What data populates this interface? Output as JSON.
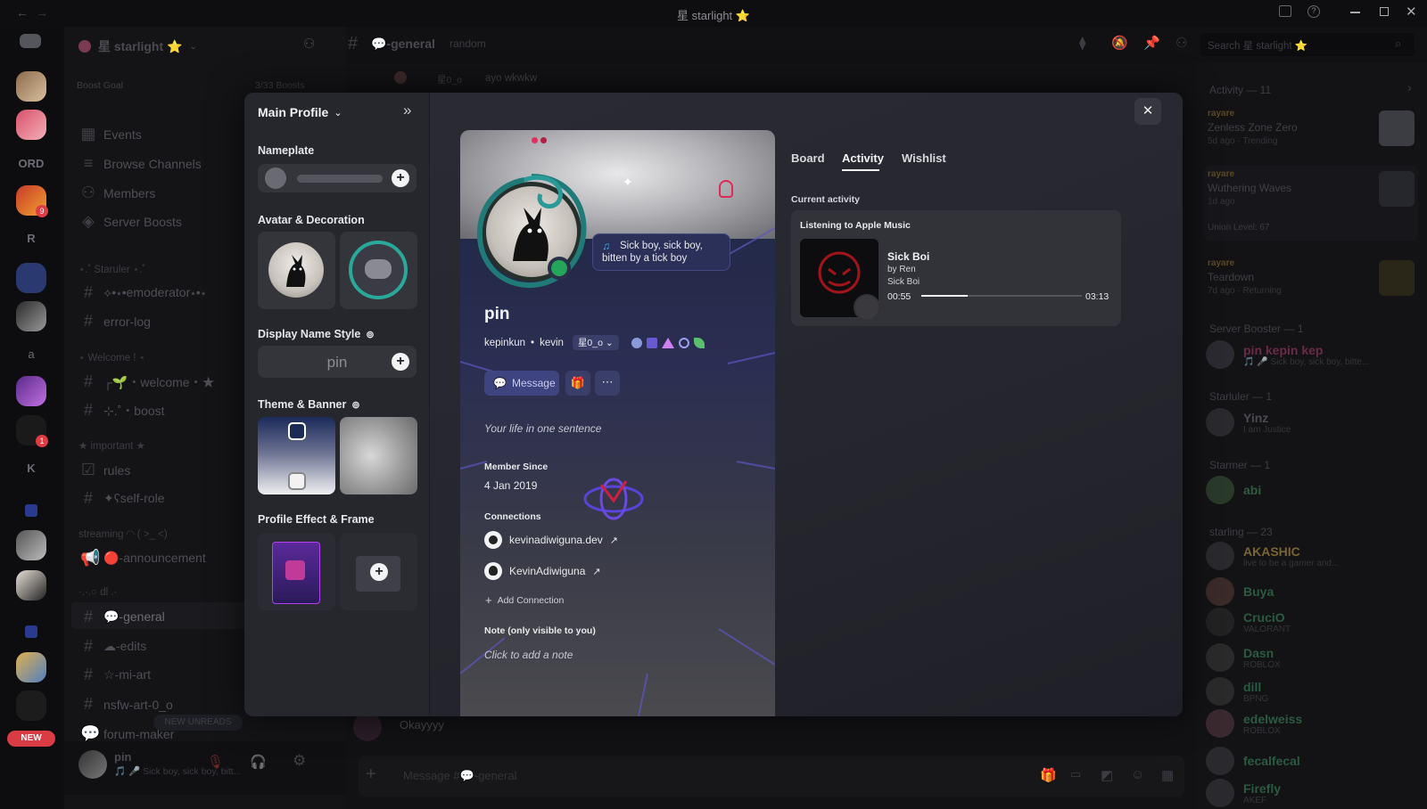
{
  "titlebar": {
    "title": "星 starlight ⭐"
  },
  "servers": {
    "labels": [
      "ORD",
      "R",
      "a",
      "K"
    ],
    "badges": [
      "9",
      "1"
    ],
    "new_label": "NEW"
  },
  "channels": {
    "server_name": "星 starlight ⭐",
    "boost_goal": "Boost Goal",
    "boost_count": "3/33 Boosts",
    "nav": [
      "Events",
      "Browse Channels",
      "Members",
      "Server Boosts"
    ],
    "cats": [
      "⋆.˚ Staruler ⋆.˚",
      "⋆ Welcome ! ⋆",
      "★ important ★",
      "streaming ◜◝ ( >_ <)",
      "·.·.○ dl .·"
    ],
    "items": [
      "⟡•⋆•emoderator⋆•⋆",
      "error-log",
      "┌🌱・welcome・★",
      "⊹.˚・boost",
      "rules",
      "✦ʕself-role",
      "🔴-announcement",
      "💬-general",
      "☁-edits",
      "☆-mi-art",
      "nsfw-art-0_o",
      "forum-maker"
    ],
    "new_unreads": "NEW UNREADS",
    "user_name": "pin",
    "user_status": "🎵 🎤 Sick boy, sick boy, bitt..."
  },
  "header": {
    "channel": "💬-general",
    "topic": "random",
    "search": "Search 星 starlight ⭐"
  },
  "messages": {
    "m1_name": "星0_o",
    "m1_text": "ayo wkwkw",
    "m2_text": "Okayyyy",
    "composer": "Message #💬-general"
  },
  "members": {
    "activity_head": "Activity — 11",
    "acts": [
      {
        "user": "rayare",
        "game": "Zenless Zone Zero",
        "meta": "5d ago  ·  Trending"
      },
      {
        "user": "rayare",
        "game": "Wuthering Waves",
        "meta": "1d ago"
      },
      {
        "user": "rayare",
        "game": "Teardown",
        "meta": "7d ago  ·  Returning"
      }
    ],
    "union_level": "Union Level: 67",
    "g1": "Server Booster — 1",
    "g2": "Starluler — 1",
    "g3": "Starmer — 1",
    "g4": "starling — 23",
    "list": [
      {
        "name": "pin kepin kep",
        "sub": "🎵 🎤 Sick boy, sick boy, bitte...",
        "color": "#7a2a4a"
      },
      {
        "name": "Yinz",
        "sub": "I am Justice",
        "color": "#9a9aa0"
      },
      {
        "name": "abi",
        "sub": "",
        "color": "#2f6b45"
      },
      {
        "name": "AKASHIC",
        "sub": "live to be a gamer and...",
        "color": "#a0823a"
      },
      {
        "name": "Buya",
        "sub": "",
        "color": "#2a6b50"
      },
      {
        "name": "CruciO",
        "sub": "VALORANT",
        "color": "#2a6b50"
      },
      {
        "name": "Dasn",
        "sub": "ROBLOX",
        "color": "#2a6b50"
      },
      {
        "name": "dill",
        "sub": "BPNG",
        "color": "#2a6b50"
      },
      {
        "name": "edelweiss",
        "sub": "ROBLOX",
        "color": "#2a6b50"
      },
      {
        "name": "fecalfecal",
        "sub": "",
        "color": "#2a6b50"
      },
      {
        "name": "Firefly",
        "sub": "AKEF",
        "color": "#2a6b50"
      }
    ]
  },
  "editor": {
    "profile_select": "Main Profile",
    "nameplate": "Nameplate",
    "avatar_decoration": "Avatar & Decoration",
    "display_name_style": "Display Name Style",
    "display_name_preview": "pin",
    "theme_banner": "Theme & Banner",
    "profile_effect": "Profile Effect & Frame"
  },
  "profile": {
    "status_bubble": "Sick boy, sick boy, bitten by a tick boy",
    "display_name": "pin",
    "username": "kepinkun",
    "pronouns": "kevin",
    "tag": "星0_o",
    "message_btn": "Message",
    "bio": "Your life in one sentence",
    "member_since_label": "Member Since",
    "member_since": "4 Jan 2019",
    "connections_label": "Connections",
    "conn1": "kevinadiwiguna.dev",
    "conn2": "KevinAdiwiguna",
    "add_connection": "Add Connection",
    "note_label": "Note (only visible to you)",
    "note_placeholder": "Click to add a note"
  },
  "tabs": [
    "Board",
    "Activity",
    "Wishlist"
  ],
  "activity": {
    "section": "Current activity",
    "listening": "Listening to Apple Music",
    "track": "Sick Boi",
    "artist": "by Ren",
    "album": "Sick Boi",
    "elapsed": "00:55",
    "total": "03:13",
    "progress": 0.29
  },
  "colors": {
    "accent": "#5865f2",
    "online": "#23a55a",
    "modal_bg": "#25262d"
  }
}
